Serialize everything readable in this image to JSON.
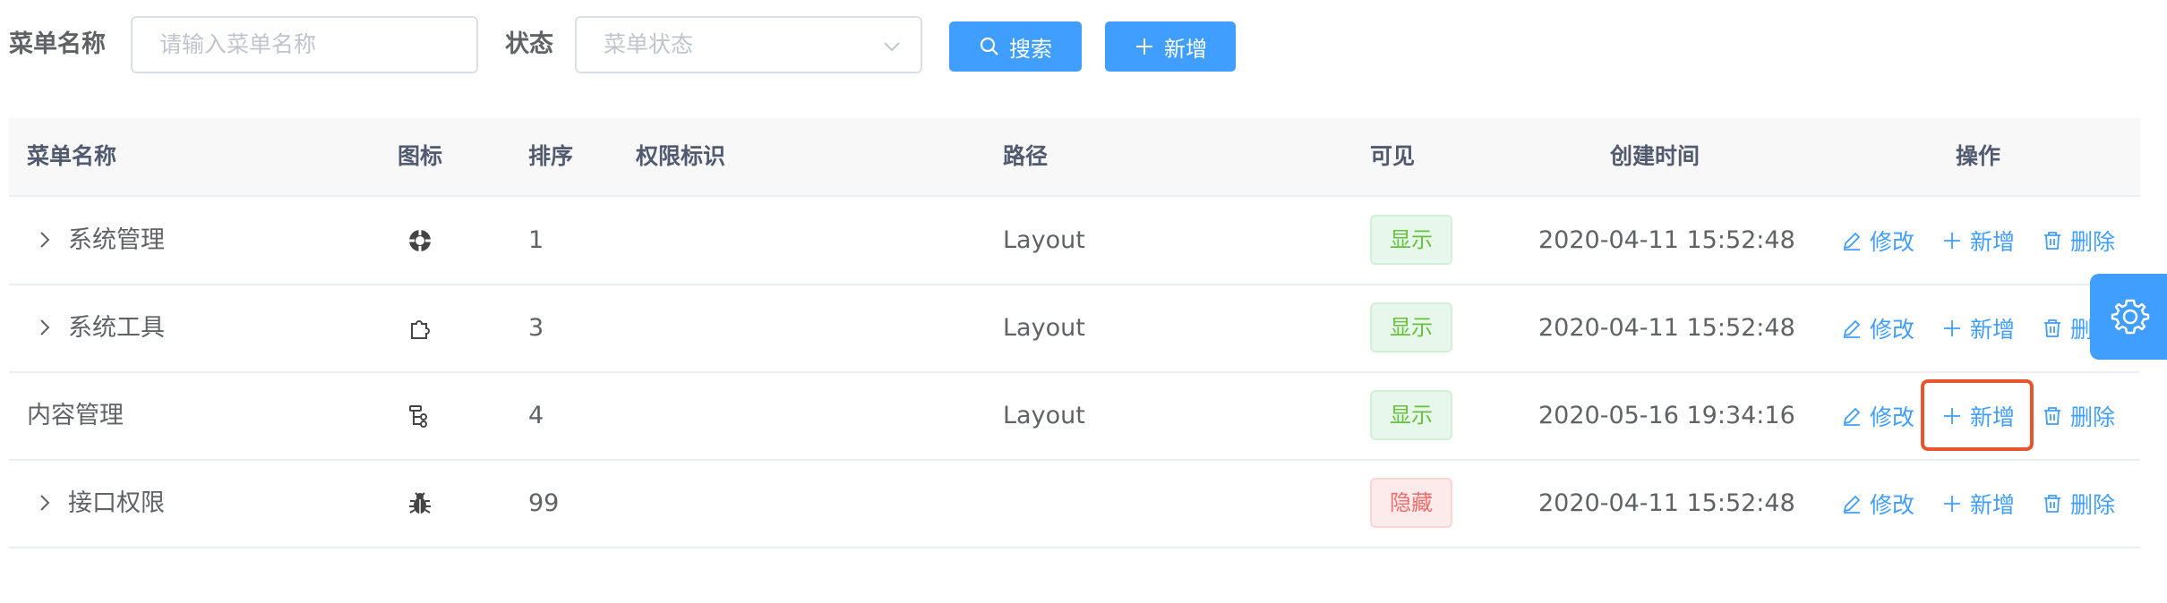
{
  "search": {
    "name_label": "菜单名称",
    "name_placeholder": "请输入菜单名称",
    "status_label": "状态",
    "status_placeholder": "菜单状态",
    "search_button": "搜索",
    "add_button": "新增"
  },
  "table": {
    "headers": {
      "name": "菜单名称",
      "icon": "图标",
      "order": "排序",
      "perms": "权限标识",
      "path": "路径",
      "visible": "可见",
      "created": "创建时间",
      "actions": "操作"
    },
    "rows": [
      {
        "name": "系统管理",
        "icon": "system-icon",
        "order": "1",
        "perms": "",
        "path": "Layout",
        "visible": "显示",
        "created": "2020-04-11 15:52:48"
      },
      {
        "name": "系统工具",
        "icon": "puzzle-icon",
        "order": "3",
        "perms": "",
        "path": "Layout",
        "visible": "显示",
        "created": "2020-04-11 15:52:48"
      },
      {
        "name": "内容管理",
        "icon": "tree-icon",
        "order": "4",
        "perms": "",
        "path": "Layout",
        "visible": "显示",
        "created": "2020-05-16 19:34:16"
      },
      {
        "name": "接口权限",
        "icon": "bug-icon",
        "order": "99",
        "perms": "",
        "path": "",
        "visible": "隐藏",
        "created": "2020-04-11 15:52:48"
      }
    ],
    "actions": {
      "edit": "修改",
      "add": "新增",
      "delete": "删除"
    }
  },
  "colors": {
    "primary": "#409eff",
    "success": "#67c23a",
    "danger": "#f56c6c",
    "highlight": "#e8542d"
  }
}
